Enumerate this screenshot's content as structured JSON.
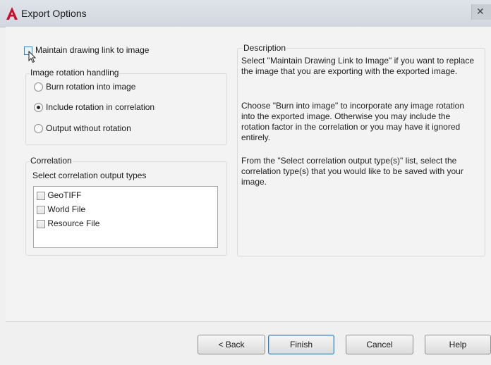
{
  "window": {
    "title": "Export Options",
    "app_icon": "autocad-a-icon",
    "accent_color": "#c8102e"
  },
  "maintain_link": {
    "label": "Maintain drawing link to image",
    "checked": false
  },
  "rotation": {
    "label": "Image rotation handling",
    "options": [
      {
        "label": "Burn rotation into image",
        "selected": false
      },
      {
        "label": "Include rotation in correlation",
        "selected": true
      },
      {
        "label": "Output without rotation",
        "selected": false
      }
    ]
  },
  "correlation": {
    "label": "Correlation",
    "list_label": "Select correlation output types",
    "types": [
      {
        "label": "GeoTIFF",
        "checked": false
      },
      {
        "label": "World File",
        "checked": false
      },
      {
        "label": "Resource File",
        "checked": false
      }
    ]
  },
  "description": {
    "label": "Description",
    "paragraphs": [
      "Select \"Maintain Drawing Link to Image\" if you want to replace the image that you are exporting with the exported image.",
      "Choose \"Burn into image\" to incorporate any image rotation into the exported image. Otherwise you may include the rotation factor in the correlation or you may have it ignored entirely.",
      "From the \"Select correlation output type(s)\" list, select the correlation type(s) that you would like to be saved with your image."
    ]
  },
  "buttons": {
    "back": "< Back",
    "finish": "Finish",
    "cancel": "Cancel",
    "help": "Help"
  }
}
